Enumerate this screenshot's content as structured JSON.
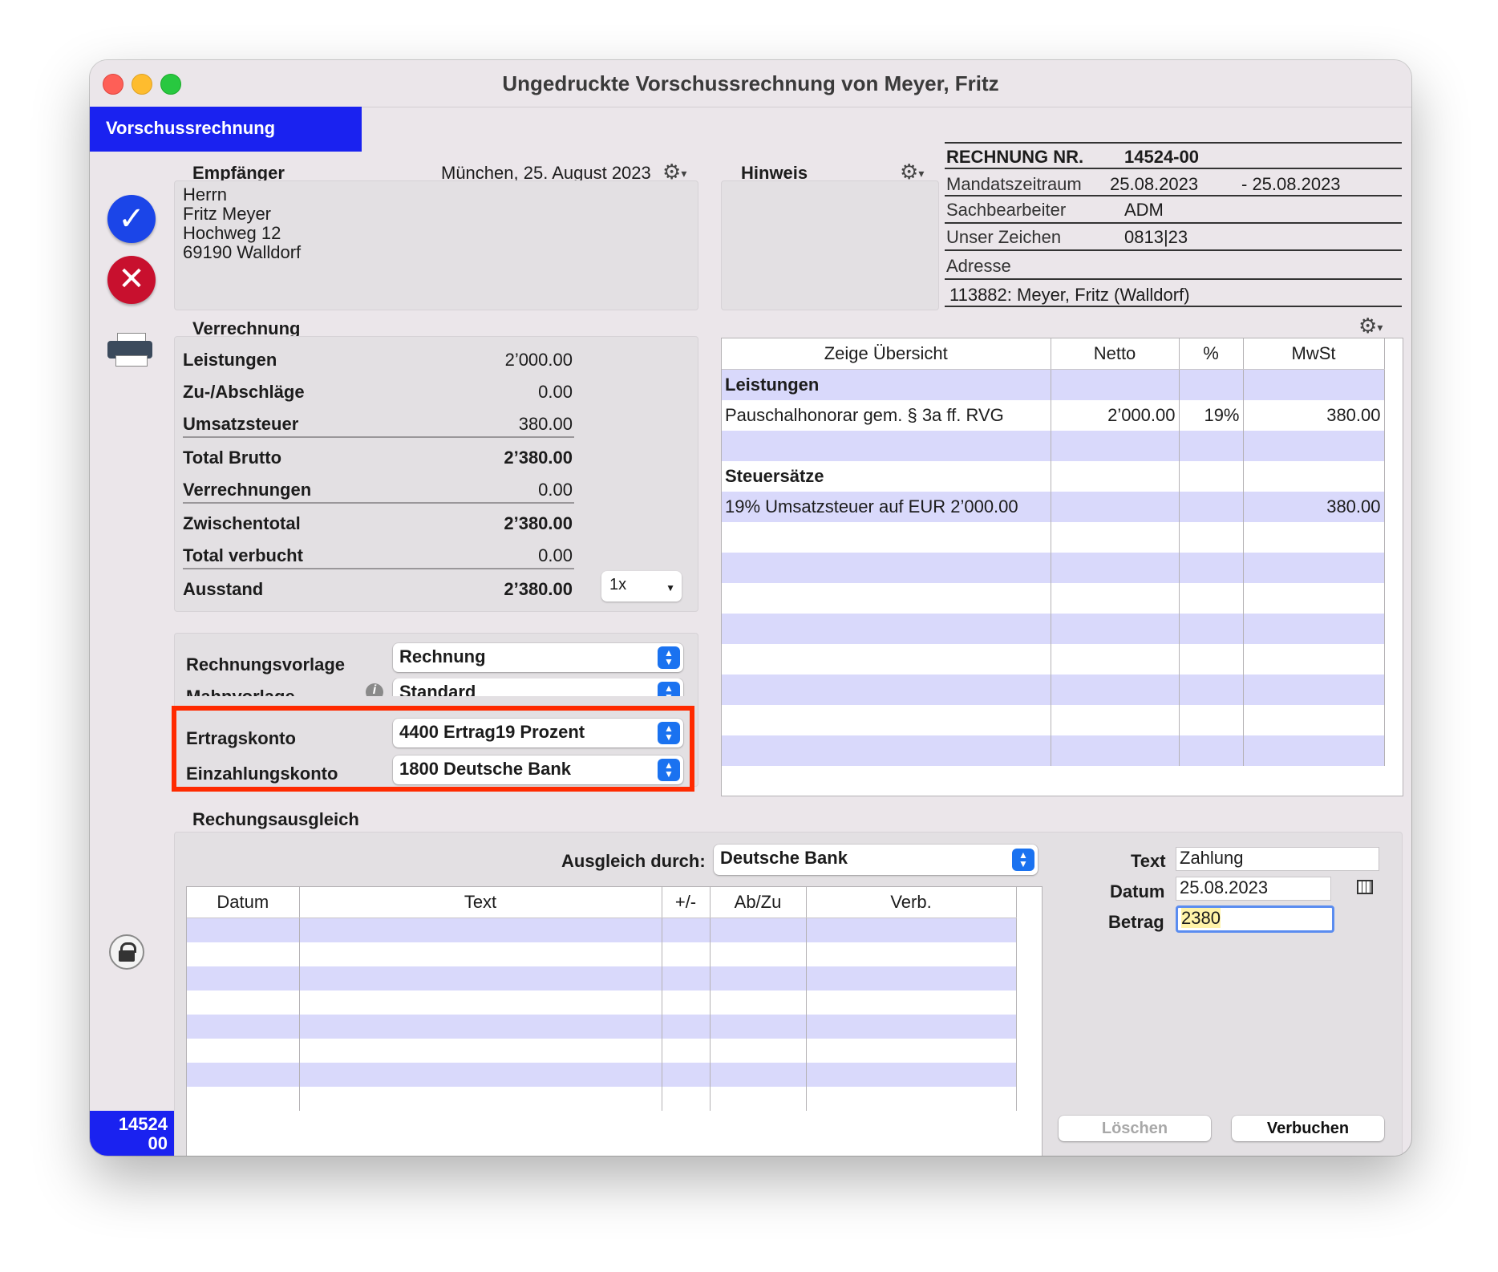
{
  "window": {
    "title": "Ungedruckte Vorschussrechnung von Meyer, Fritz"
  },
  "tab": {
    "label": "Vorschussrechnung"
  },
  "sidebar": {
    "doc_number_line1": "14524",
    "doc_number_line2": "00"
  },
  "recipient": {
    "heading": "Empfänger",
    "date": "München, 25. August 2023",
    "lines": [
      "Herrn",
      "Fritz Meyer",
      "Hochweg 12",
      "69190 Walldorf"
    ]
  },
  "note": {
    "heading": "Hinweis"
  },
  "invoice_info": {
    "number_label": "RECHNUNG NR.",
    "number": "14524-00",
    "period_label": "Mandatszeitraum",
    "period_from": "25.08.2023",
    "period_to": "- 25.08.2023",
    "clerk_label": "Sachbearbeiter",
    "clerk": "ADM",
    "ref_label": "Unser Zeichen",
    "ref": "0813|23",
    "address_label": "Adresse",
    "address": "113882: Meyer, Fritz (Walldorf)"
  },
  "settlement": {
    "heading": "Verrechnung",
    "rows": [
      {
        "label": "Leistungen",
        "value": "2’000.00"
      },
      {
        "label": "Zu-/Abschläge",
        "value": "0.00"
      },
      {
        "label": "Umsatzsteuer",
        "value": "380.00"
      },
      {
        "label": "Total Brutto",
        "value": "2’380.00"
      },
      {
        "label": "Verrechnungen",
        "value": "0.00"
      },
      {
        "label": "Zwischentotal",
        "value": "2’380.00"
      },
      {
        "label": "Total verbucht",
        "value": "0.00"
      },
      {
        "label": "Ausstand",
        "value": "2’380.00"
      }
    ],
    "multiplier": "1x"
  },
  "templates": {
    "invoice_template_label": "Rechnungsvorlage",
    "invoice_template": "Rechnung",
    "reminder_template_label": "Mahnvorlage",
    "reminder_template": "Standard",
    "revenue_account_label": "Ertragskonto",
    "revenue_account": "4400 Ertrag19 Prozent",
    "deposit_account_label": "Einzahlungskonto",
    "deposit_account": "1800 Deutsche Bank"
  },
  "overview": {
    "columns": [
      "Zeige Übersicht",
      "Netto",
      "%",
      "MwSt"
    ],
    "rows": [
      [
        "Leistungen",
        "",
        "",
        ""
      ],
      [
        "Pauschalhonorar gem. § 3a ff. RVG",
        "2’000.00",
        "19%",
        "380.00"
      ],
      [
        "",
        "",
        "",
        ""
      ],
      [
        "Steuersätze",
        "",
        "",
        ""
      ],
      [
        "19% Umsatzsteuer auf EUR 2’000.00",
        "",
        "",
        "380.00"
      ],
      [
        "",
        "",
        "",
        ""
      ],
      [
        "",
        "",
        "",
        ""
      ],
      [
        "",
        "",
        "",
        ""
      ],
      [
        "",
        "",
        "",
        ""
      ],
      [
        "",
        "",
        "",
        ""
      ],
      [
        "",
        "",
        "",
        ""
      ],
      [
        "",
        "",
        "",
        ""
      ],
      [
        "",
        "",
        "",
        ""
      ]
    ]
  },
  "payment": {
    "heading": "Rechungsausgleich",
    "method_label": "Ausgleich durch:",
    "method": "Deutsche Bank",
    "columns": [
      "Datum",
      "Text",
      "+/-",
      "Ab/Zu",
      "Verb."
    ],
    "text_label": "Text",
    "text_value": "Zahlung",
    "date_label": "Datum",
    "date_value": "25.08.2023",
    "amount_label": "Betrag",
    "amount_value": "2380",
    "delete_label": "Löschen",
    "book_label": "Verbuchen"
  },
  "colors": {
    "accent": "#1a22f0",
    "highlight": "#ff2a00",
    "row_blue": "#d9d9fb"
  }
}
